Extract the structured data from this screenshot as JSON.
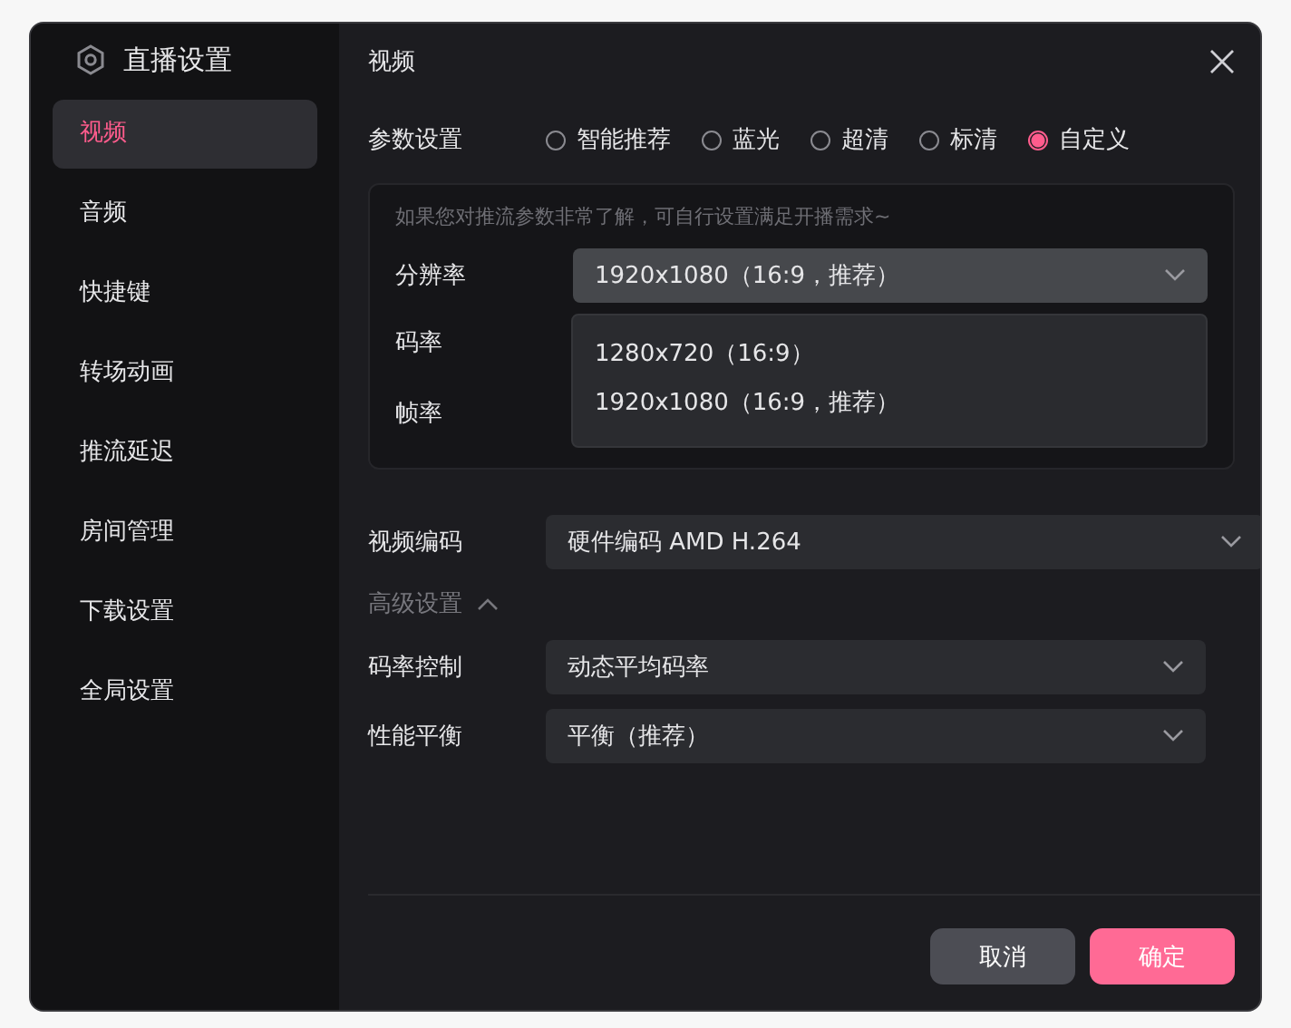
{
  "sidebar": {
    "title": "直播设置",
    "items": [
      {
        "label": "视频",
        "selected": true
      },
      {
        "label": "音频",
        "selected": false
      },
      {
        "label": "快捷键",
        "selected": false
      },
      {
        "label": "转场动画",
        "selected": false
      },
      {
        "label": "推流延迟",
        "selected": false
      },
      {
        "label": "房间管理",
        "selected": false
      },
      {
        "label": "下载设置",
        "selected": false
      },
      {
        "label": "全局设置",
        "selected": false
      }
    ]
  },
  "header": {
    "title": "视频"
  },
  "preset": {
    "label": "参数设置",
    "options": [
      {
        "label": "智能推荐",
        "selected": false
      },
      {
        "label": "蓝光",
        "selected": false
      },
      {
        "label": "超清",
        "selected": false
      },
      {
        "label": "标清",
        "selected": false
      },
      {
        "label": "自定义",
        "selected": true
      }
    ]
  },
  "custom_panel": {
    "hint": "如果您对推流参数非常了解，可自行设置满足开播需求~",
    "resolution": {
      "label": "分辨率",
      "value": "1920x1080（16:9，推荐）",
      "expanded": true,
      "options": [
        "1280x720（16:9）",
        "1920x1080（16:9，推荐）"
      ]
    },
    "bitrate": {
      "label": "码率"
    },
    "framerate": {
      "label": "帧率"
    }
  },
  "encoder": {
    "label": "视频编码",
    "value": "硬件编码 AMD H.264"
  },
  "advanced": {
    "label": "高级设置",
    "expanded": true,
    "fields": [
      {
        "label": "码率控制",
        "value": "动态平均码率"
      },
      {
        "label": "性能平衡",
        "value": "平衡（推荐）"
      }
    ]
  },
  "buttons": {
    "cancel": "取消",
    "confirm": "确定"
  }
}
